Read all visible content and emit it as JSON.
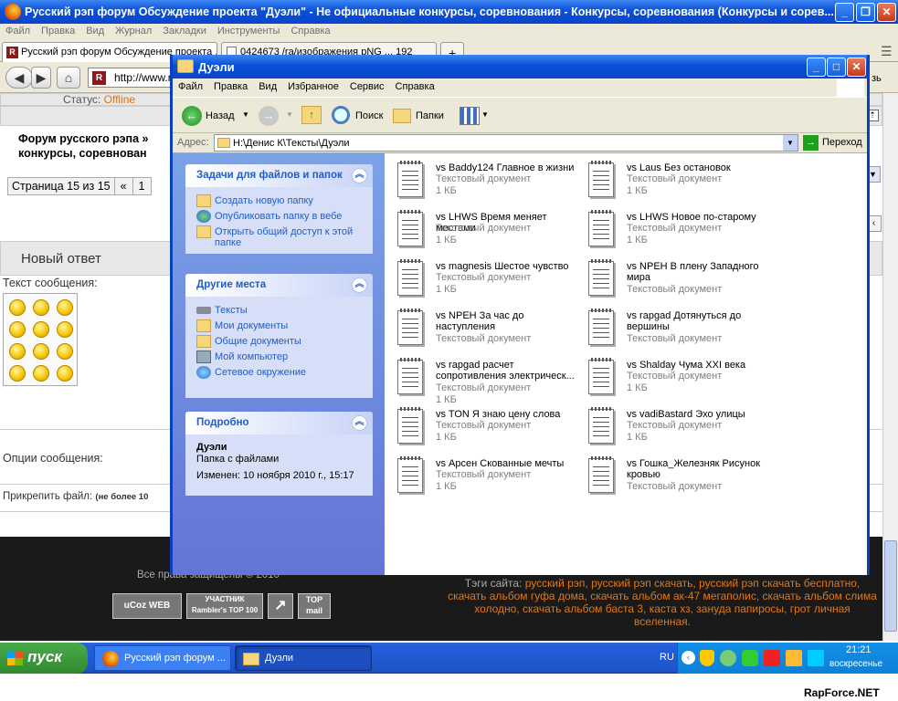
{
  "firefox": {
    "title": "Русский рэп форум Обсуждение проекта \"Дуэли\" - Не официальные конкурсы, соревнования - Конкурсы, соревнования (Конкурсы и сорев...",
    "menu": [
      "Файл",
      "Правка",
      "Вид",
      "Журнал",
      "Закладки",
      "Инструменты",
      "Справка"
    ],
    "tabs": [
      "Русский рэп форум Обсуждение проекта ...",
      "0424673 /ra/изображения рNG ... 192"
    ],
    "url": "http://www.r",
    "right_overflow": "зь"
  },
  "forum": {
    "status_label": "Статус:",
    "status_value": "Offline",
    "heading_line1": "Форум русского рэпа »",
    "heading_line2": "конкурсы, соревнован",
    "pagination": [
      "Страница 15 из 15",
      "«",
      "1"
    ],
    "new_reply": "Новый ответ",
    "message_text_label": "Текст сообщения:",
    "options_label": "Опции сообщения:",
    "attach_label": "Прикрепить файл:",
    "attach_note": "(не более 10",
    "copyright": "Все права защищены © 2010",
    "tags_label": "Тэги сайта:",
    "tags": "русский рэп, русский рэп скачать, русский рэп скачать бесплатно, скачать альбом гуфа дома, скачать альбом ак-47 мегаполис, скачать альбом слима холодно, скачать альбом баста 3, каста хз, занудa папиросы, грот личная вселенная.",
    "badges": [
      "uCoz WEB",
      "УЧАСТНИК Rambler's TOP 100",
      "↗",
      "TOP mail"
    ]
  },
  "explorer": {
    "title": "Дуэли",
    "menu": [
      "Файл",
      "Правка",
      "Вид",
      "Избранное",
      "Сервис",
      "Справка"
    ],
    "toolbar": {
      "back": "Назад",
      "search": "Поиск",
      "folders": "Папки"
    },
    "address_label": "Адрес:",
    "address_value": "H:\\Денис К\\Тексты\\Дуэли",
    "go": "Переход",
    "tasks": {
      "title": "Задачи для файлов и папок",
      "items": [
        "Создать новую папку",
        "Опубликовать папку в вебе",
        "Открыть общий доступ к этой папке"
      ]
    },
    "places": {
      "title": "Другие места",
      "items": [
        "Тексты",
        "Мои документы",
        "Общие документы",
        "Мой компьютер",
        "Сетевое окружение"
      ]
    },
    "details": {
      "title": "Подробно",
      "name": "Дуэли",
      "type": "Папка с файлами",
      "modified": "Изменен: 10 ноября 2010 г., 15:17"
    },
    "files": [
      {
        "name": "vs Baddy124 Главное в жизни",
        "type": "Текстовый документ",
        "size": "1 КБ"
      },
      {
        "name": "vs Laus Без остановок",
        "type": "Текстовый документ",
        "size": "1 КБ"
      },
      {
        "name": "vs LHWS Время меняет местами",
        "type": "Текстовый документ",
        "size": "1 КБ"
      },
      {
        "name": "vs LHWS Новое по-старому",
        "type": "Текстовый документ",
        "size": "1 КБ"
      },
      {
        "name": "vs magnesis Шестое чувство",
        "type": "Текстовый документ",
        "size": "1 КБ"
      },
      {
        "name": "vs NPEH В плену Западного мира",
        "type": "Текстовый документ",
        "size": ""
      },
      {
        "name": "vs NPEH За час до наступления",
        "type": "Текстовый документ",
        "size": ""
      },
      {
        "name": "vs rapgad Дотянуться до вершины",
        "type": "Текстовый документ",
        "size": ""
      },
      {
        "name": "vs rapgad расчет сопротивления электрическ...",
        "type": "Текстовый документ",
        "size": "1 КБ"
      },
      {
        "name": "vs Shalday Чума XXI века",
        "type": "Текстовый документ",
        "size": "1 КБ"
      },
      {
        "name": "vs TON  Я знаю цену слова",
        "type": "Текстовый документ",
        "size": "1 КБ"
      },
      {
        "name": "vs vadiBastard Эхо улицы",
        "type": "Текстовый документ",
        "size": "1 КБ"
      },
      {
        "name": "vs Арсен Скованные мечты",
        "type": "Текстовый документ",
        "size": "1 КБ"
      },
      {
        "name": "vs Гошка_Железняк Рисунок кровью",
        "type": "Текстовый документ",
        "size": ""
      }
    ]
  },
  "taskbar": {
    "start": "пуск",
    "tasks": [
      "Русский рэп форум ...",
      "Дуэли"
    ],
    "lang": "RU",
    "time": "21:21",
    "day": "воскресенье"
  },
  "watermark": "RapForce.NET"
}
